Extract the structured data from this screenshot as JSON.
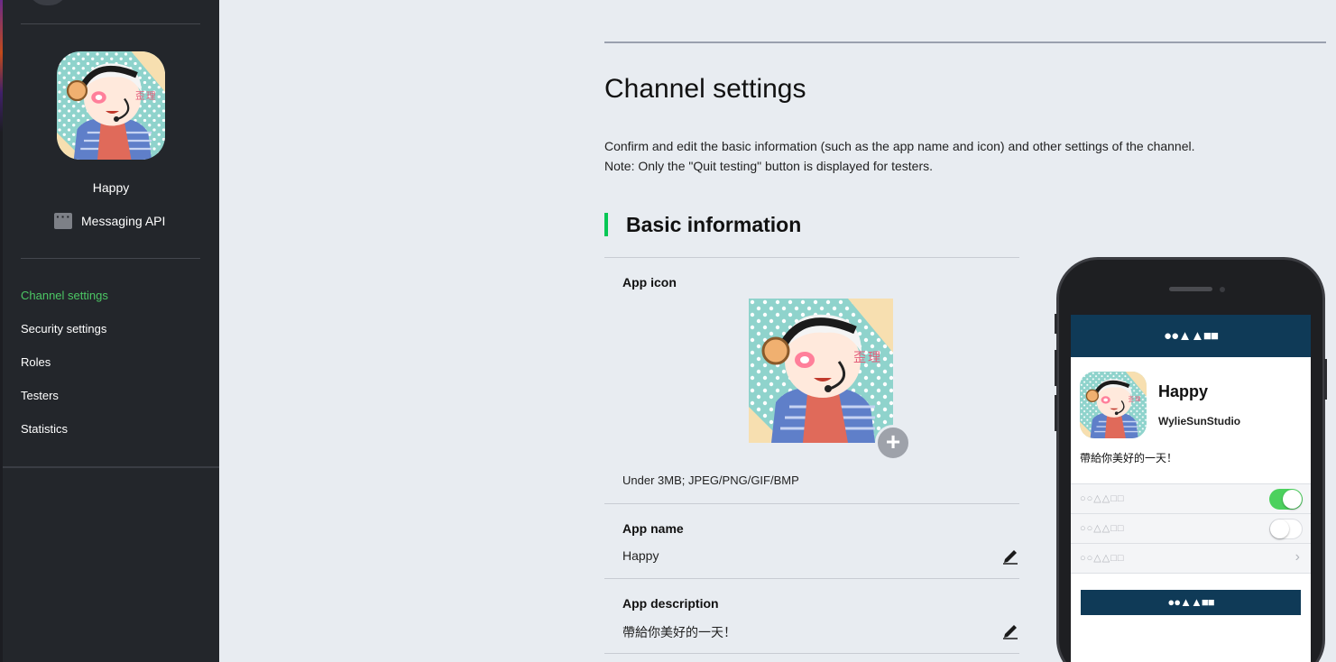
{
  "sidebar": {
    "channel_name": "Happy",
    "channel_type": "Messaging API",
    "nav": [
      {
        "label": "Channel settings",
        "active": true
      },
      {
        "label": "Security settings",
        "active": false
      },
      {
        "label": "Roles",
        "active": false
      },
      {
        "label": "Testers",
        "active": false
      },
      {
        "label": "Statistics",
        "active": false
      }
    ]
  },
  "main": {
    "title": "Channel settings",
    "intro_line1": "Confirm and edit the basic information (such as the app name and icon) and other settings of the channel.",
    "intro_line2": "Note: Only the \"Quit testing\" button is displayed for testers.",
    "section_title": "Basic information",
    "app_icon": {
      "label": "App icon",
      "hint": "Under 3MB; JPEG/PNG/GIF/BMP"
    },
    "app_name": {
      "label": "App name",
      "value": "Happy"
    },
    "app_description": {
      "label": "App description",
      "value": "帶給你美好的一天！"
    }
  },
  "preview": {
    "header": "●●▲▲■■",
    "name": "Happy",
    "studio": "WylieSunStudio",
    "description": "帶給你美好的一天！",
    "rows": [
      {
        "label": "○○△△□□",
        "control": "toggle-on"
      },
      {
        "label": "○○△△□□",
        "control": "toggle-off"
      },
      {
        "label": "○○△△□□",
        "control": "chevron"
      }
    ],
    "button": "●●▲▲■■"
  },
  "colors": {
    "sidebar_bg": "#23262b",
    "accent_green": "#4cc764",
    "section_bar": "#06c755",
    "page_bg": "#e8ecf1",
    "preview_header": "#0f3a57",
    "toggle_on": "#4cd15e"
  }
}
